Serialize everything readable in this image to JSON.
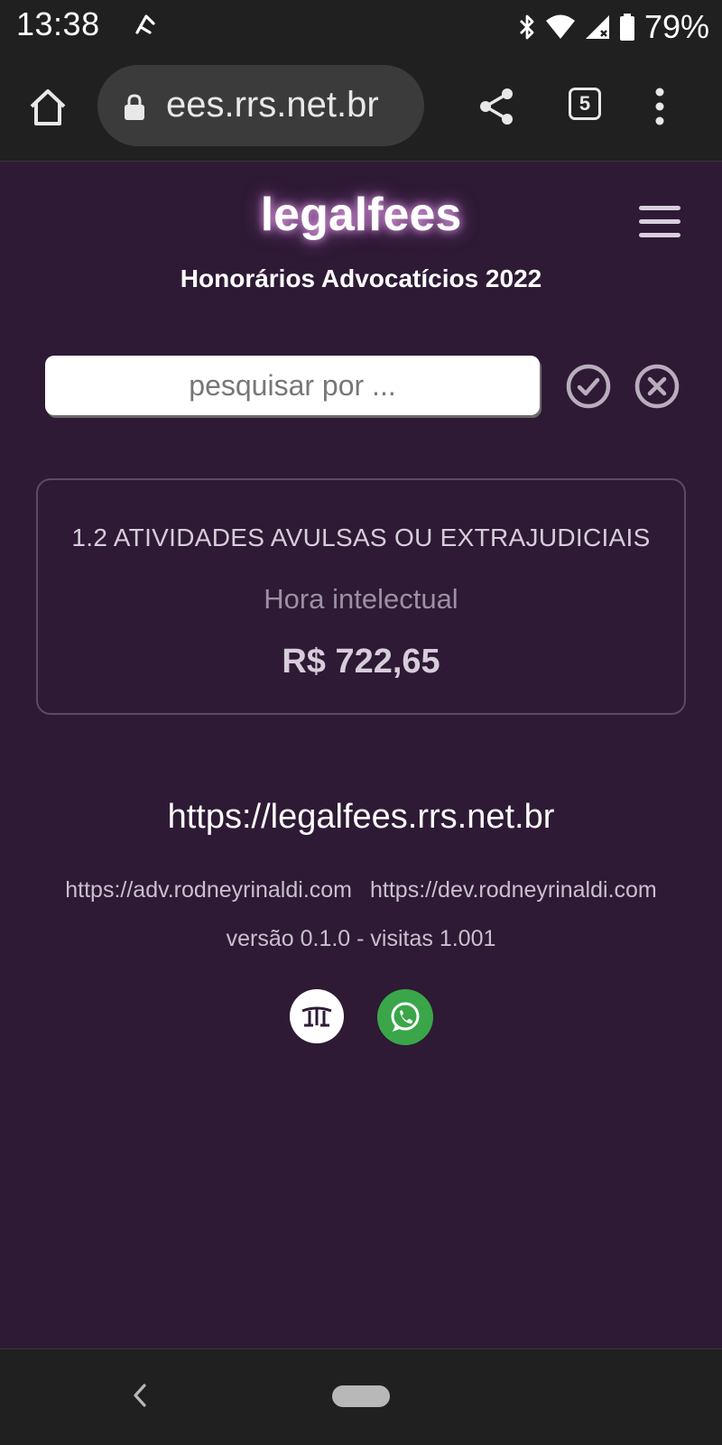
{
  "status_bar": {
    "time": "13:38",
    "battery": "79%"
  },
  "browser": {
    "url": "ees.rrs.net.br",
    "tab_count": "5"
  },
  "header": {
    "brand": "legalfees",
    "subtitle": "Honorários Advocatícios 2022"
  },
  "search": {
    "placeholder": "pesquisar por ..."
  },
  "result": {
    "category": "1.2 ATIVIDADES AVULSAS OU EXTRAJUDICIAIS",
    "activity": "Hora intelectual",
    "price": "R$ 722,65"
  },
  "footer": {
    "site_url": "https://legalfees.rrs.net.br",
    "link_adv": "https://adv.rodneyrinaldi.com",
    "link_dev": "https://dev.rodneyrinaldi.com",
    "version": "versão 0.1.0 - visitas 1.001"
  },
  "icons": {
    "social_logo": "rr-logo-icon",
    "social_whatsapp": "whatsapp-icon"
  },
  "colors": {
    "background": "#2e1a35",
    "system_bars": "#202020",
    "whatsapp": "#3aa649",
    "brand_glow": "#e68cff"
  }
}
